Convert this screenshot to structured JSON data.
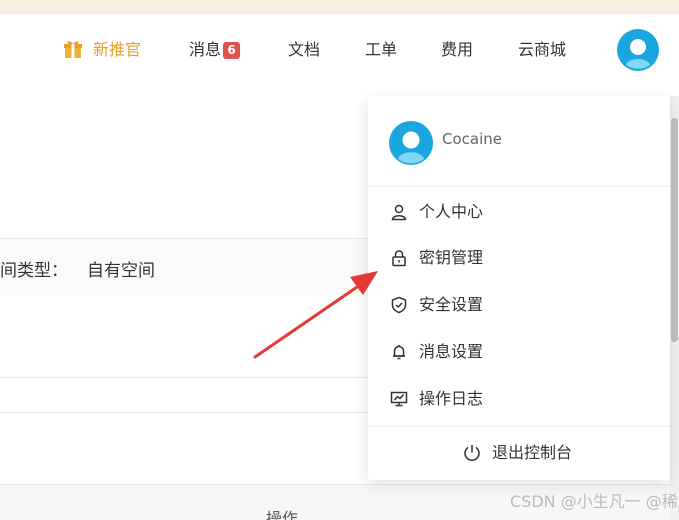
{
  "navbar": {
    "promo_label": "新推官",
    "messages_label": "消息",
    "messages_count": "6",
    "docs_label": "文档",
    "tickets_label": "工单",
    "billing_label": "费用",
    "market_label": "云商城"
  },
  "content": {
    "space_type_label": "间类型：",
    "space_type_value": "自有空间",
    "table_op_header": "操作"
  },
  "user_menu": {
    "username": "Cocaine",
    "items": [
      {
        "label": "个人中心",
        "icon": "user-icon"
      },
      {
        "label": "密钥管理",
        "icon": "lock-icon"
      },
      {
        "label": "安全设置",
        "icon": "shield-icon"
      },
      {
        "label": "消息设置",
        "icon": "bell-icon"
      },
      {
        "label": "操作日志",
        "icon": "monitor-chart-icon"
      }
    ],
    "logout_label": "退出控制台",
    "logout_icon": "power-icon"
  },
  "colors": {
    "promo": "#e8a02a",
    "badge": "#e05252",
    "avatar": "#1aa7e0",
    "arrow": "#e53935"
  },
  "watermark": "CSDN @小生凡一 @稀土掘金技术社区"
}
